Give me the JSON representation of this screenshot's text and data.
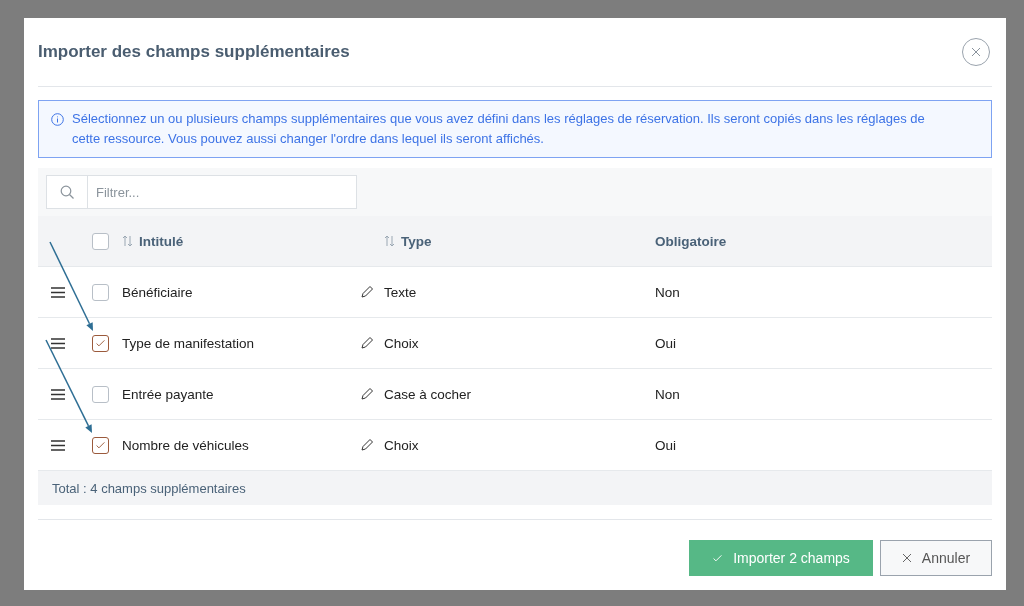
{
  "dialog": {
    "title": "Importer des champs supplémentaires",
    "info": "Sélectionnez un ou plusieurs champs supplémentaires que vous avez défini dans les réglages de réservation. Ils seront copiés dans les réglages de cette ressource. Vous pouvez aussi changer l'ordre dans lequel ils seront affichés."
  },
  "filter": {
    "placeholder": "Filtrer..."
  },
  "table": {
    "select_all": {
      "checked": false
    },
    "columns": [
      {
        "label": "Intitulé",
        "sortable": true
      },
      {
        "label": "Type",
        "sortable": true
      },
      {
        "label": "Obligatoire",
        "sortable": false
      }
    ],
    "rows": [
      {
        "title": "Bénéficiaire",
        "type": "Texte",
        "required": "Non",
        "checked": false
      },
      {
        "title": "Type de manifestation",
        "type": "Choix",
        "required": "Oui",
        "checked": true
      },
      {
        "title": "Entrée payante",
        "type": "Case à cocher",
        "required": "Non",
        "checked": false
      },
      {
        "title": "Nombre de véhicules",
        "type": "Choix",
        "required": "Oui",
        "checked": true
      }
    ],
    "total": "Total : 4 champs supplémentaires"
  },
  "buttons": [
    {
      "kind": "primary",
      "label": "Importer 2 champs"
    },
    {
      "kind": "cancel",
      "label": "Annuler"
    }
  ]
}
